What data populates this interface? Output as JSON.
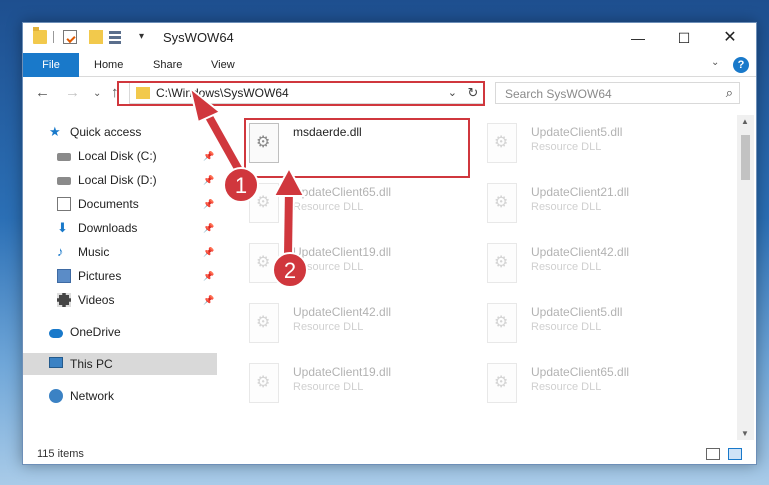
{
  "window": {
    "title": "SysWOW64",
    "controls": {
      "minimize": "—",
      "maximize": "☐",
      "close": "✕"
    }
  },
  "ribbon": {
    "tabs": {
      "file": "File",
      "home": "Home",
      "share": "Share",
      "view": "View"
    },
    "expand": "⌄",
    "help": "?"
  },
  "nav": {
    "back": "←",
    "forward": "→",
    "recent": "⌄",
    "up": "↑",
    "address": "C:\\Windows\\SysWOW64",
    "address_dropdown": "⌄",
    "refresh": "↻",
    "search_placeholder": "Search SysWOW64",
    "search_icon": "⌕"
  },
  "sidebar": {
    "quick_access": "Quick access",
    "items": [
      {
        "label": "Local Disk (C:)",
        "pinned": true
      },
      {
        "label": "Local Disk (D:)",
        "pinned": true
      },
      {
        "label": "Documents",
        "pinned": true
      },
      {
        "label": "Downloads",
        "pinned": true
      },
      {
        "label": "Music",
        "pinned": true
      },
      {
        "label": "Pictures",
        "pinned": true
      },
      {
        "label": "Videos",
        "pinned": true
      }
    ],
    "onedrive": "OneDrive",
    "this_pc": "This PC",
    "network": "Network",
    "pin_glyph": "📌"
  },
  "files": [
    {
      "name": "msdaerde.dll",
      "type": ""
    },
    {
      "name": "UpdateClient5.dll",
      "type": "Resource DLL"
    },
    {
      "name": "UpdateClient65.dll",
      "type": "Resource DLL"
    },
    {
      "name": "UpdateClient21.dll",
      "type": "Resource DLL"
    },
    {
      "name": "UpdateClient19.dll",
      "type": "Resource DLL"
    },
    {
      "name": "UpdateClient42.dll",
      "type": "Resource DLL"
    },
    {
      "name": "UpdateClient42.dll",
      "type": "Resource DLL"
    },
    {
      "name": "UpdateClient5.dll",
      "type": "Resource DLL"
    },
    {
      "name": "UpdateClient19.dll",
      "type": "Resource DLL"
    },
    {
      "name": "UpdateClient65.dll",
      "type": "Resource DLL"
    }
  ],
  "annotations": {
    "step1": "1",
    "step2": "2",
    "color": "#d0373d"
  },
  "status": {
    "item_count": "115 items"
  },
  "scrollbar": {
    "up": "▲",
    "down": "▼"
  }
}
